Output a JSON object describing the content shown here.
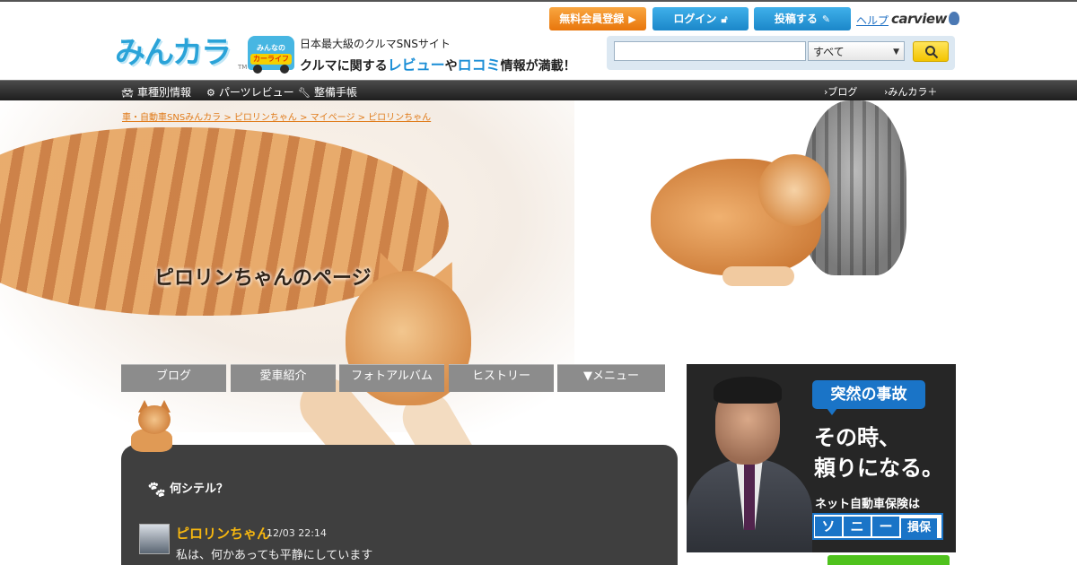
{
  "header": {
    "logo_text": "みんカラ",
    "logo_tm": "TM",
    "badge_line1": "みんなの",
    "badge_line2": "カーライフ",
    "tagline1": "日本最大級のクルマSNSサイト",
    "tagline2_pre": "クルマに関する",
    "tagline2_hl1": "レビュー",
    "tagline2_mid": "や",
    "tagline2_hl2": "ロコミ",
    "tagline2_post": "情報が満載！",
    "signup_label": "無料会員登録",
    "login_label": "ログイン",
    "post_label": "投稿する",
    "help_label": "ヘルプ",
    "carview_logo": "carview",
    "search": {
      "value": "",
      "placeholder": "",
      "select_value": "すべて",
      "search_icon": "magnifier-icon"
    }
  },
  "nav": {
    "items": [
      {
        "label": "車種別情報",
        "icon": "car-icon"
      },
      {
        "label": "パーツレビュー",
        "icon": "gear-icon"
      },
      {
        "label": "整備手帳",
        "icon": "wrench-icon"
      }
    ],
    "right_items": [
      "ブログ",
      "みんカラ＋"
    ]
  },
  "breadcrumb": "車・自動車SNSみんカラ > ピロリンちゃん > マイページ > ピロリンちゃん",
  "page_title": "ピロリンちゃんのページ",
  "tabs": [
    "ブログ",
    "愛車紹介",
    "フォトアルバム",
    "ヒストリー",
    "▼メニュー"
  ],
  "status": {
    "heading": "何シテル？",
    "user_name": "ピロリンちゃん",
    "time": "12/03 22:14",
    "text": "私は、何かあっても平静にしています"
  },
  "ad": {
    "bubble": "突然の事故",
    "line1": "その時、",
    "line2": "頼りになる。",
    "line3": "ネット自動車保険は",
    "brand_chars": [
      "ソ",
      "ニ",
      "ー",
      "損",
      "保"
    ]
  },
  "colors": {
    "accent_blue": "#1b87c9",
    "signup_orange": "#e8760c",
    "username_yellow": "#f7b70f",
    "breadcrumb_orange": "#e07b1a"
  }
}
